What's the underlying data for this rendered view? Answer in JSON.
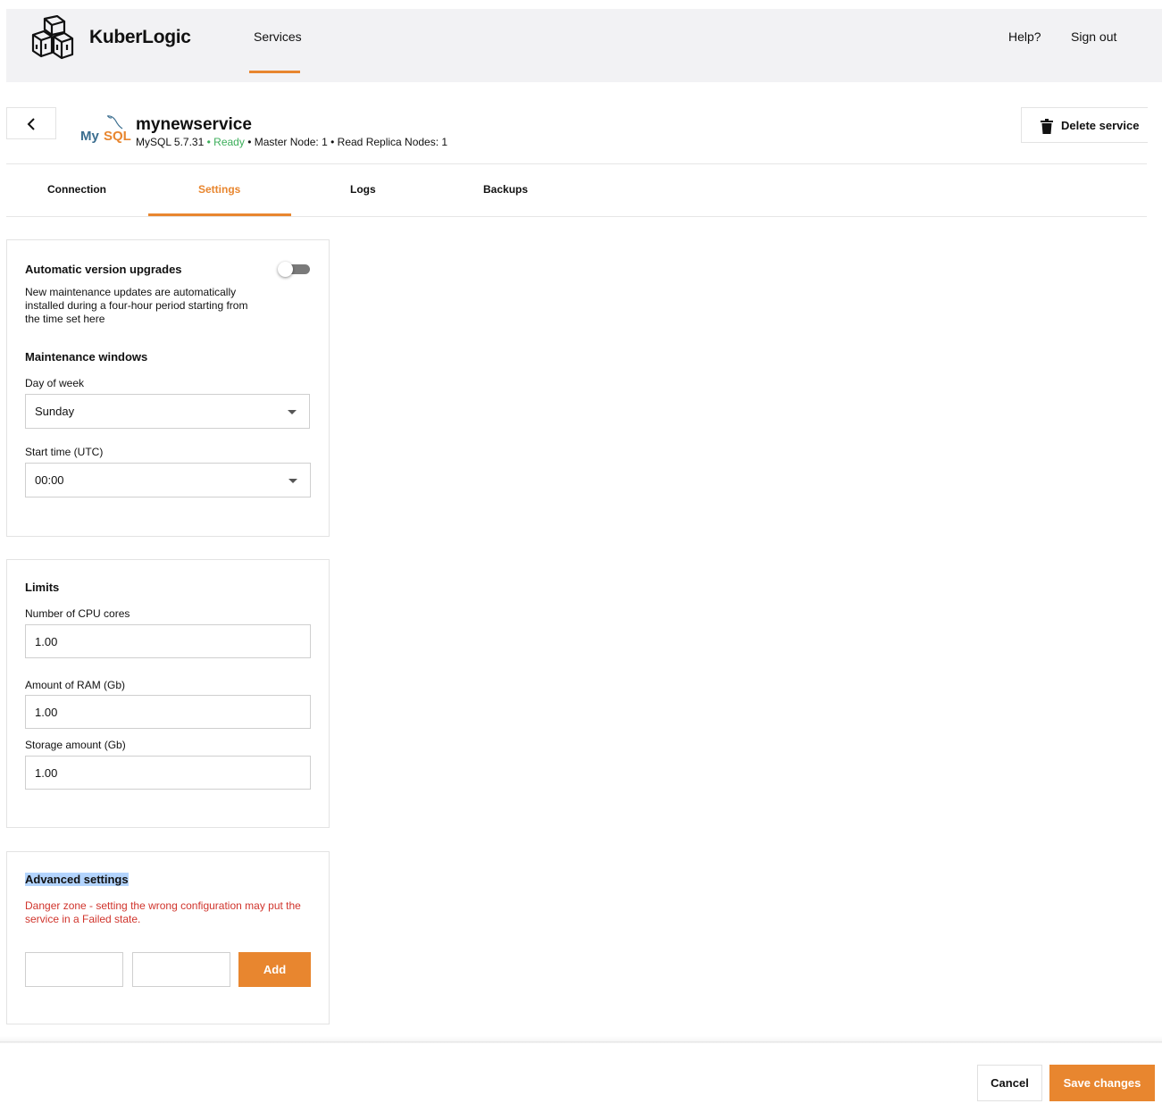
{
  "app": {
    "name": "KuberLogic"
  },
  "nav": {
    "services": "Services",
    "help": "Help?",
    "sign_out": "Sign out"
  },
  "service": {
    "name": "mynewservice",
    "type_version": "MySQL 5.7.31",
    "status": "Ready",
    "master_nodes": "Master Node: 1",
    "replica_nodes": "Read Replica Nodes: 1",
    "logo_my": "My",
    "logo_sql": "SQL",
    "delete_label": "Delete service"
  },
  "tabs": [
    {
      "label": "Connection",
      "active": false
    },
    {
      "label": "Settings",
      "active": true
    },
    {
      "label": "Logs",
      "active": false
    },
    {
      "label": "Backups",
      "active": false
    }
  ],
  "upgrades": {
    "title": "Automatic version upgrades",
    "description": "New maintenance updates are automatically installed during a four-hour period starting from the time set here",
    "enabled": false
  },
  "maintenance": {
    "title": "Maintenance windows",
    "day_label": "Day of week",
    "day_value": "Sunday",
    "time_label": "Start time (UTC)",
    "time_value": "00:00"
  },
  "limits": {
    "title": "Limits",
    "cpu_label": "Number of CPU cores",
    "cpu_value": "1.00",
    "ram_label": "Amount of RAM (Gb)",
    "ram_value": "1.00",
    "storage_label": "Storage amount (Gb)",
    "storage_value": "1.00"
  },
  "advanced": {
    "title": "Advanced settings",
    "warning": "Danger zone - setting the wrong configuration may put the service in a Failed state.",
    "key_value": "",
    "value_value": "",
    "add_label": "Add"
  },
  "footer": {
    "cancel": "Cancel",
    "save": "Save changes"
  },
  "colors": {
    "accent": "#e8862f",
    "ready": "#3cae5a",
    "danger": "#d0342c"
  }
}
